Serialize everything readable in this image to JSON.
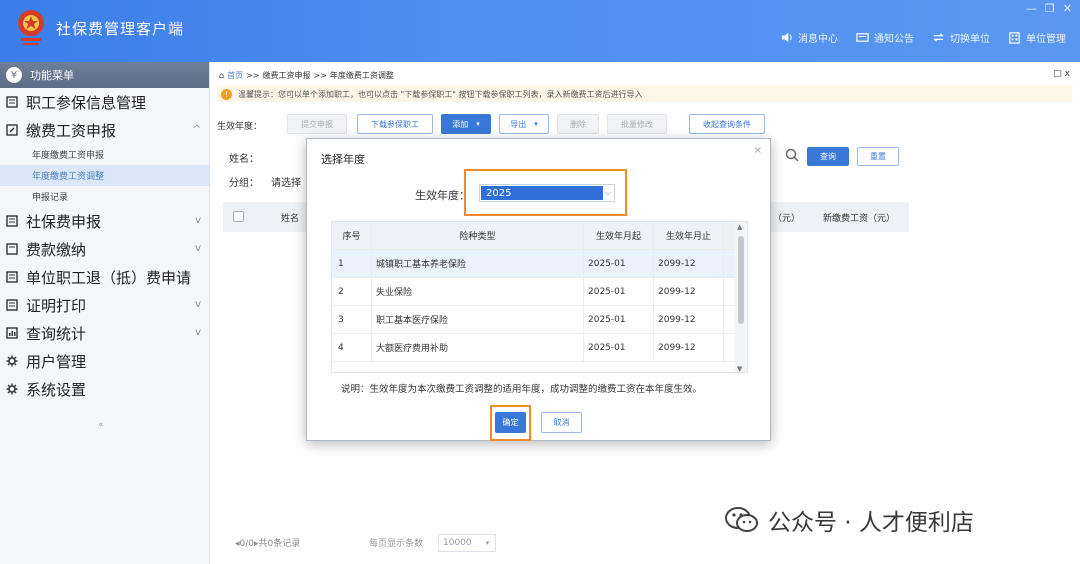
{
  "app": {
    "title": "社保费管理客户端",
    "top_actions": [
      "消息中心",
      "通知公告",
      "切换单位",
      "单位管理"
    ],
    "window_controls": [
      "—",
      "❐",
      "✕"
    ]
  },
  "sidebar": {
    "header": "功能菜单",
    "items": [
      {
        "label": "职工参保信息管理",
        "icon": "grid-icon",
        "chevron": ""
      },
      {
        "label": "缴费工资申报",
        "icon": "edit-icon",
        "chevron": "^"
      },
      {
        "label": "社保费申报",
        "icon": "grid-icon",
        "chevron": "v"
      },
      {
        "label": "费款缴纳",
        "icon": "grid-icon",
        "chevron": "v"
      },
      {
        "label": "单位职工退（抵）费申请",
        "icon": "grid-icon",
        "chevron": ""
      },
      {
        "label": "证明打印",
        "icon": "grid-icon",
        "chevron": "v"
      },
      {
        "label": "查询统计",
        "icon": "chart-icon",
        "chevron": "v"
      },
      {
        "label": "用户管理",
        "icon": "gear-icon",
        "chevron": ""
      },
      {
        "label": "系统设置",
        "icon": "gear-icon",
        "chevron": ""
      }
    ],
    "sub_items": [
      "年度缴费工资申报",
      "年度缴费工资调整",
      "申报记录"
    ],
    "collapse": "«"
  },
  "main": {
    "breadcrumb": {
      "home": "首页",
      "sep": ">>",
      "level1": "缴费工资申报",
      "level2": "年度缴费工资调整"
    },
    "close": "□ x",
    "tip": "温馨提示：您可以单个添加职工，也可以点击 \"下载参保职工\" 按钮下载参保职工列表，录入新缴费工资后进行导入",
    "toolbar": {
      "label": "生效年度：",
      "buttons": [
        "提交申报",
        "下载参保职工",
        "添加",
        "导出",
        "删除",
        "批量修改",
        "收起查询条件"
      ]
    },
    "filters": {
      "name_label": "姓名：",
      "group_label": "分组：",
      "group_placeholder": "请选择",
      "search": "查询",
      "reset": "重置"
    },
    "grid_headers": [
      "姓名",
      "（元）",
      "新缴费工资（元）"
    ],
    "pager": {
      "nav": "◂0/0▸共0条记录",
      "size_label": "每页显示条数",
      "size_value": "10000"
    }
  },
  "dialog": {
    "title": "选择年度",
    "close": "×",
    "year_label": "生效年度：",
    "year_value": "2025",
    "table": {
      "headers": [
        "序号",
        "险种类型",
        "生效年月起",
        "生效年月止"
      ],
      "rows": [
        [
          "1",
          "城镇职工基本养老保险",
          "2025-01",
          "2099-12"
        ],
        [
          "2",
          "失业保险",
          "2025-01",
          "2099-12"
        ],
        [
          "3",
          "职工基本医疗保险",
          "2025-01",
          "2099-12"
        ],
        [
          "4",
          "大额医疗费用补助",
          "2025-01",
          "2099-12"
        ]
      ]
    },
    "note": "说明：生效年度为本次缴费工资调整的适用年度，成功调整的缴费工资在本年度生效。",
    "ok": "确定",
    "cancel": "取消"
  },
  "watermark": "公众号 · 人才便利店",
  "colors": {
    "header": "#4f8ff0",
    "primary": "#3a78d8",
    "highlight": "#f08a2a"
  }
}
